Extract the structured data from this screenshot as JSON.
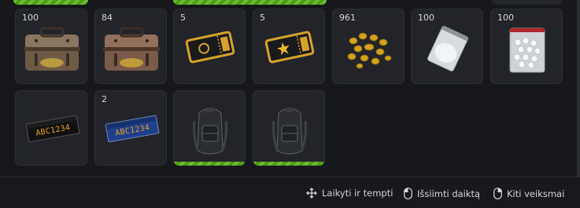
{
  "items": [
    {
      "name": "ammo-crate-1",
      "qty": "100"
    },
    {
      "name": "ammo-crate-2",
      "qty": "84"
    },
    {
      "name": "gold-ticket-emblem",
      "qty": "5"
    },
    {
      "name": "gold-ticket-star",
      "qty": "5"
    },
    {
      "name": "gold-nuggets",
      "qty": "961"
    },
    {
      "name": "white-powder-bag",
      "qty": "100"
    },
    {
      "name": "white-pills-bag",
      "qty": "100"
    },
    {
      "name": "license-plate-black",
      "qty": ""
    },
    {
      "name": "license-plate-blue",
      "qty": "2"
    },
    {
      "name": "backpack-1",
      "qty": ""
    },
    {
      "name": "backpack-2",
      "qty": ""
    }
  ],
  "plates": {
    "black_text": "ABC1234",
    "blue_text": "ABC1234"
  },
  "footer": {
    "drag_hint": "Laikyti ir tempti",
    "take_hint": "Išsiimti daiktą",
    "other_hint": "Kiti veiksmai"
  },
  "colors": {
    "accent_green": "#6cbd2c",
    "slot_bg": "#22242a",
    "page_bg": "#17181c"
  }
}
